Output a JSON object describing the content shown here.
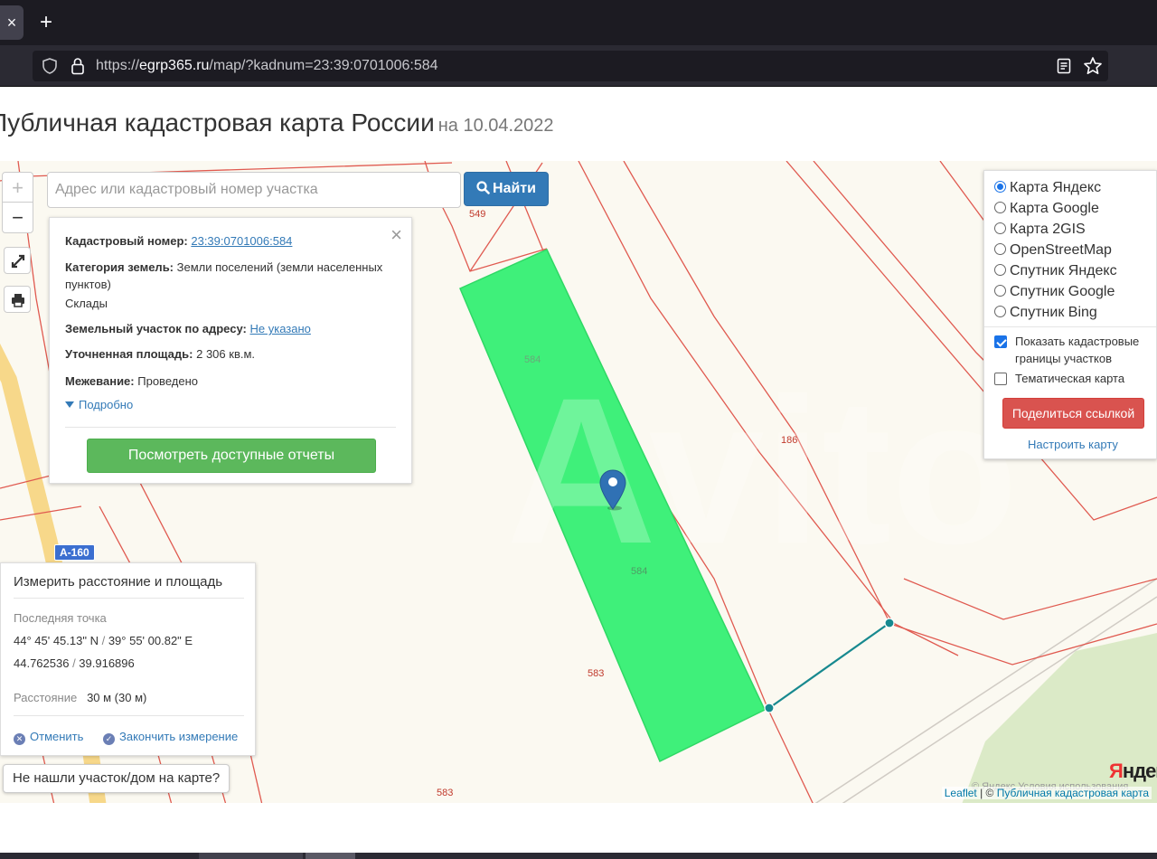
{
  "browser": {
    "tab_close": "×",
    "new_tab": "+",
    "url_scheme": "https://",
    "url_host": "egrp365.ru",
    "url_path": "/map/?kadnum=23:39:0701006:584"
  },
  "page": {
    "title": "Публичная кадастровая карта России",
    "date": "на 10.04.2022"
  },
  "map_controls": {
    "zoom_in": "+",
    "zoom_out": "−"
  },
  "search": {
    "placeholder": "Адрес или кадастровый номер участка",
    "button": "Найти"
  },
  "info": {
    "close": "×",
    "cadastral_label": "Кадастровый номер:",
    "cadastral_value": "23:39:0701006:584",
    "category_label": "Категория земель:",
    "category_value": "Земли поселений (земли населенных",
    "category_value2": "пунктов)",
    "category_value3": "Склады",
    "address_label": "Земельный участок по адресу:",
    "address_value": "Не указано",
    "area_label": "Уточненная площадь:",
    "area_value": "2 306 кв.м.",
    "survey_label": "Межевание:",
    "survey_value": "Проведено",
    "more": "Подробно",
    "reports_button": "Посмотреть доступные отчеты"
  },
  "layers": {
    "options": [
      {
        "label": "Карта Яндекс",
        "selected": true
      },
      {
        "label": "Карта Google",
        "selected": false
      },
      {
        "label": "Карта 2GIS",
        "selected": false
      },
      {
        "label": "OpenStreetMap",
        "selected": false
      },
      {
        "label": "Спутник Яндекс",
        "selected": false
      },
      {
        "label": "Спутник Google",
        "selected": false
      },
      {
        "label": "Спутник Bing",
        "selected": false
      }
    ],
    "show_borders": "Показать кадастровые границы участков",
    "thematic": "Тематическая карта",
    "share_button": "Поделиться ссылкой",
    "customize": "Настроить карту"
  },
  "measure": {
    "title": "Измерить расстояние и площадь",
    "last_point_label": "Последняя точка",
    "dms_lat": "44° 45' 45.13\" N",
    "dms_sep": " / ",
    "dms_lon": "39° 55' 00.82\" E",
    "dec_lat": "44.762536",
    "dec_sep": " / ",
    "dec_lon": "39.916896",
    "distance_label": "Расстояние",
    "distance_value": "30 м (30 м)",
    "cancel": "Отменить",
    "finish": "Закончить измерение"
  },
  "not_found": "Не нашли участок/дом на карте?",
  "parcel_labels": {
    "p549": "549",
    "p584a": "584",
    "p584b": "584",
    "p186": "186",
    "p583a": "583",
    "p583b": "583"
  },
  "road": "А-160",
  "attribution": {
    "leaflet": "Leaflet",
    "sep": " | © ",
    "pkk": "Публичная кадастровая карта",
    "faint": "© Яндекс  Условия использования"
  },
  "yandex_logo_red": "Я",
  "yandex_logo_dark": "ндекс",
  "colors": {
    "parcel_fill": "#3ff07a",
    "parcel_border": "#e05a50",
    "primary": "#337ab7",
    "success": "#5cb85c",
    "danger": "#d9534f",
    "measure_line": "#17898f"
  }
}
